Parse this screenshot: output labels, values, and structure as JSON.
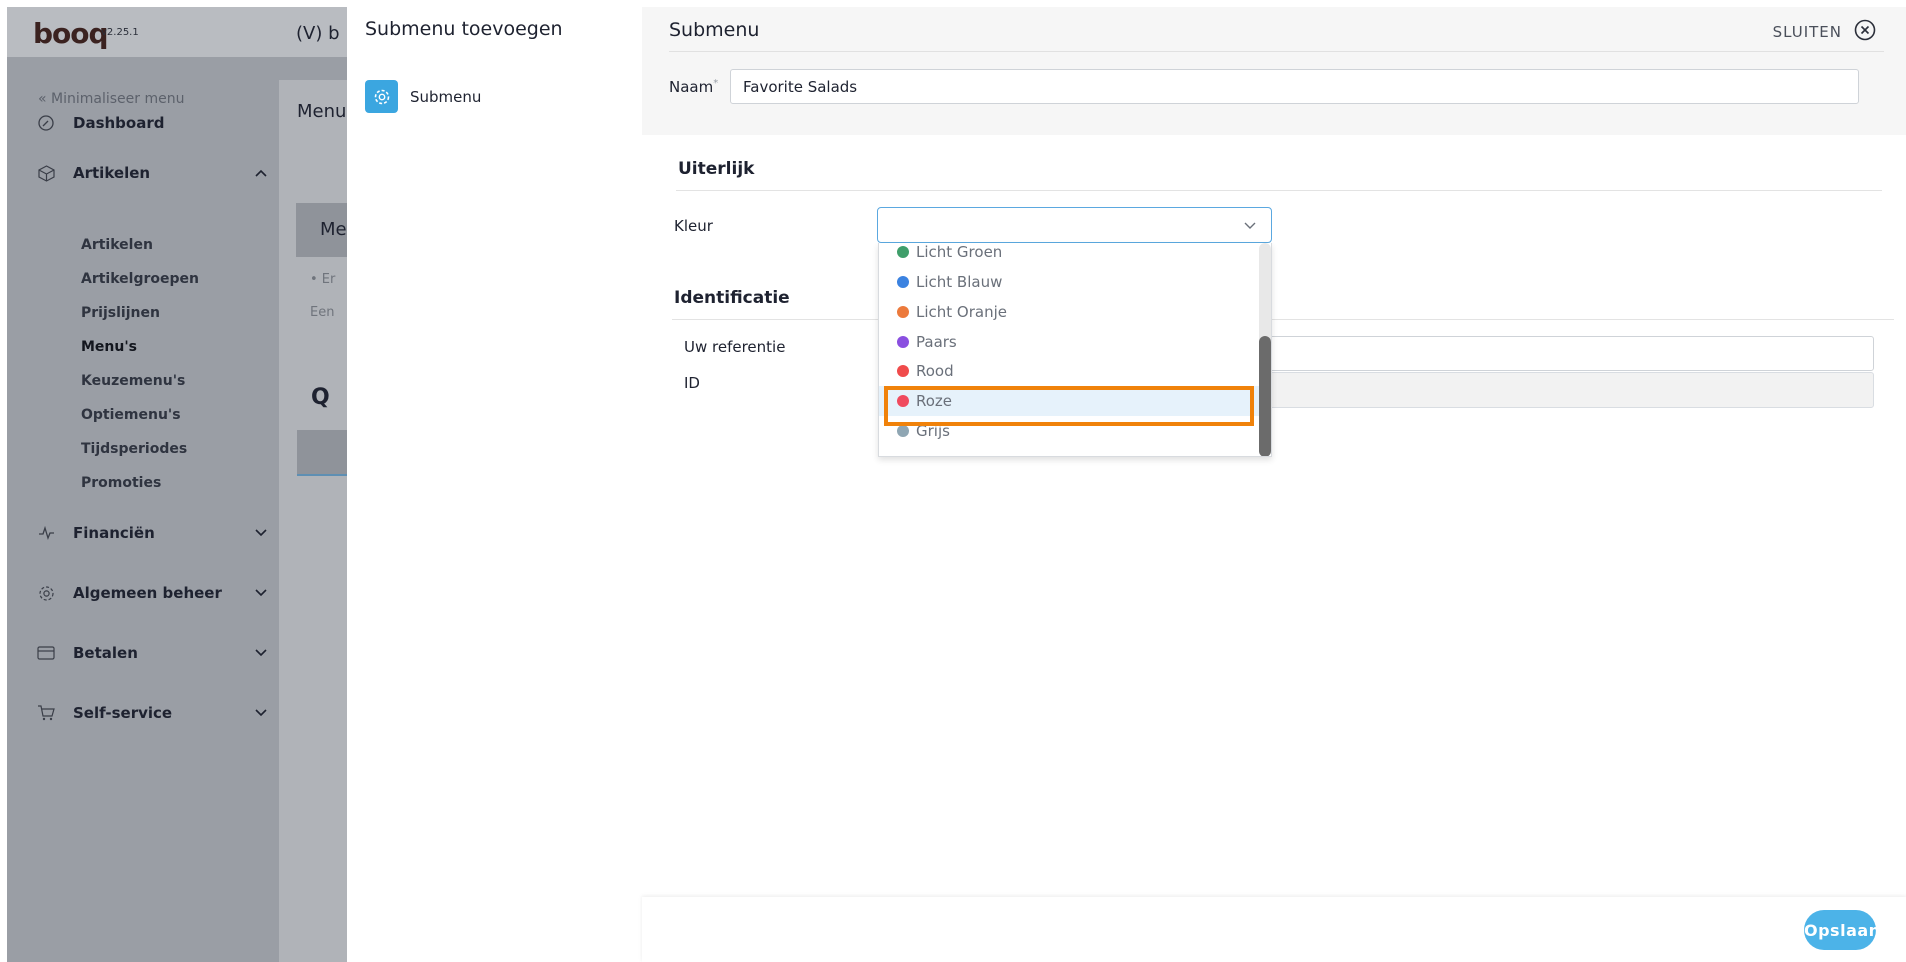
{
  "app": {
    "logo": "booq",
    "version": "v2.25.1",
    "venue_title": "(V) b"
  },
  "sidebar": {
    "minimize_label": "« Minimaliseer menu",
    "dashboard": "Dashboard",
    "articles": {
      "label": "Artikelen",
      "items": [
        "Artikelen",
        "Artikelgroepen",
        "Prijslijnen",
        "Menu's",
        "Keuzemenu's",
        "Optiemenu's",
        "Tijdsperiodes",
        "Promoties"
      ],
      "active_item": "Menu's"
    },
    "finance": "Financiën",
    "general": "Algemeen beheer",
    "payments": "Betalen",
    "selfservice": "Self-service"
  },
  "background_page": {
    "heading": "Menu",
    "card_title": "Mer",
    "bullet_text": "• Er",
    "sub_text": "Een",
    "search_glyph": "Q"
  },
  "modal_left": {
    "title": "Submenu toevoegen",
    "item_label": "Submenu"
  },
  "modal": {
    "title": "Submenu",
    "close_label": "SLUITEN",
    "name_label": "Naam",
    "name_required_mark": "*",
    "name_value": "Favorite Salads",
    "appearance_section": "Uiterlijk",
    "color_label": "Kleur",
    "identification_section": "Identificatie",
    "reference_label": "Uw referentie",
    "id_label": "ID",
    "save_label": "Opslaan"
  },
  "color_options": [
    {
      "label": "Licht Groen",
      "color": "#3f9e6a"
    },
    {
      "label": "Licht Blauw",
      "color": "#3b82e0"
    },
    {
      "label": "Licht Oranje",
      "color": "#ec7a3c"
    },
    {
      "label": "Paars",
      "color": "#8a4fe0"
    },
    {
      "label": "Rood",
      "color": "#f04b4b"
    },
    {
      "label": "Roze",
      "color": "#f04a5e"
    },
    {
      "label": "Grijs",
      "color": "#8fa6b3"
    }
  ],
  "highlighted_option": "Roze",
  "colors": {
    "accent": "#4cb3e8",
    "highlight_border": "#f0820a"
  }
}
